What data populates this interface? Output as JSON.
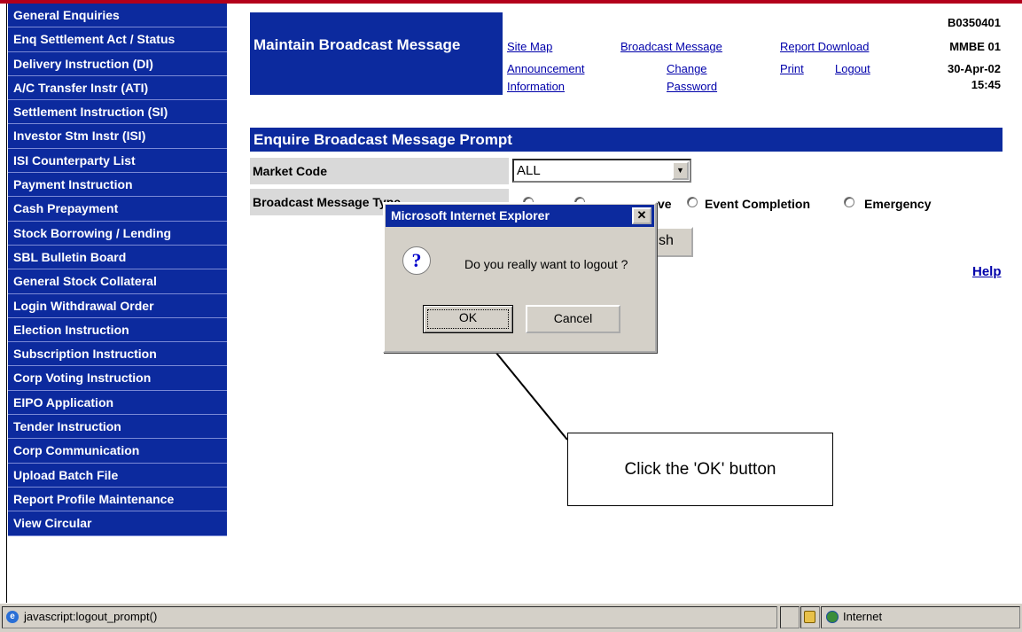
{
  "sidebar": {
    "items": [
      "General Enquiries",
      "Enq Settlement Act / Status",
      "Delivery Instruction (DI)",
      "A/C Transfer Instr (ATI)",
      "Settlement Instruction (SI)",
      "Investor Stm Instr (ISI)",
      "ISI Counterparty List",
      "Payment Instruction",
      "Cash Prepayment",
      "Stock Borrowing / Lending",
      "SBL Bulletin Board",
      "General Stock Collateral",
      "Login Withdrawal Order",
      "Election Instruction",
      "Subscription Instruction",
      "Corp Voting Instruction",
      "EIPO Application",
      "Tender Instruction",
      "Corp Communication",
      "Upload Batch File",
      "Report Profile Maintenance",
      "View Circular"
    ]
  },
  "header": {
    "title": "Maintain Broadcast Message",
    "links": {
      "site_map": "Site Map",
      "broadcast_message": "Broadcast Message",
      "report_download": "Report Download",
      "announcement_line1": "Announcement",
      "announcement_line2": "Information",
      "change_line1": "Change",
      "change_line2": "Password",
      "print": "Print",
      "logout": "Logout"
    },
    "meta": {
      "code": "B0350401",
      "screen": "MMBE 01",
      "date": "30-Apr-02",
      "time": "15:45"
    }
  },
  "form": {
    "section_title": "Enquire Broadcast Message Prompt",
    "market_code_label": "Market Code",
    "market_code_value": "ALL",
    "message_type_label": "Broadcast Message Type",
    "radio_partial": "ve",
    "radio_event": "Event Completion",
    "radio_emergency": "Emergency",
    "refresh_partial": "sh",
    "help": "Help"
  },
  "dialog": {
    "title": "Microsoft Internet Explorer",
    "message": "Do you really want to logout ?",
    "ok": "OK",
    "cancel": "Cancel",
    "close": "✕"
  },
  "annotation": {
    "text": "Click the 'OK' button"
  },
  "statusbar": {
    "text": "javascript:logout_prompt()",
    "zone": "Internet"
  },
  "colors": {
    "nav_blue": "#0c2a9e",
    "top_accent": "#b3001b",
    "link": "#0000aa"
  }
}
